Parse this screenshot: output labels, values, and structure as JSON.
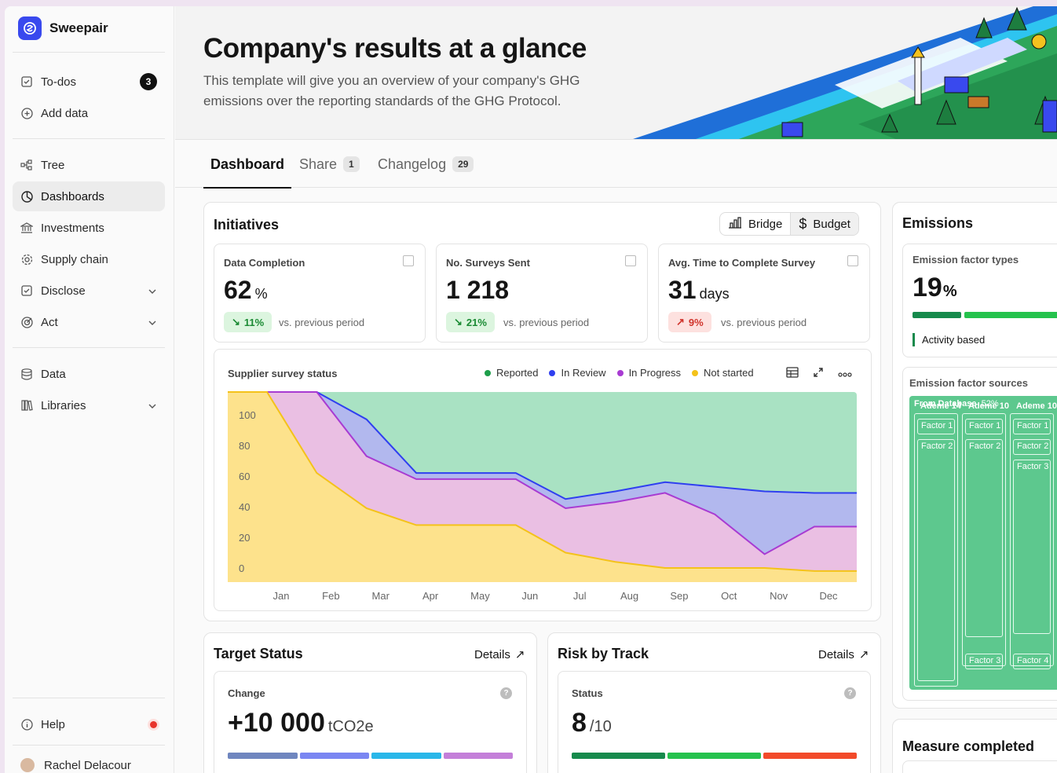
{
  "app": {
    "name": "Sweepair"
  },
  "sidebar": {
    "todos": {
      "label": "To-dos",
      "count": "3"
    },
    "add_data": "Add data",
    "tree": "Tree",
    "dashboards": "Dashboards",
    "investments": "Investments",
    "supply_chain": "Supply chain",
    "disclose": "Disclose",
    "act": "Act",
    "data": "Data",
    "libraries": "Libraries",
    "help": "Help",
    "user": "Rachel Delacour"
  },
  "header": {
    "title": "Company's results at a glance",
    "subtitle": "This template will give you an overview of your company's GHG emissions over the reporting standards of the GHG Protocol."
  },
  "tabs": [
    {
      "label": "Dashboard",
      "count": ""
    },
    {
      "label": "Share",
      "count": "1"
    },
    {
      "label": "Changelog",
      "count": "29"
    }
  ],
  "initiatives": {
    "title": "Initiatives",
    "toggle": [
      "Bridge",
      "Budget"
    ],
    "kpis": [
      {
        "label": "Data Completion",
        "value": "62",
        "unit": "%",
        "change": "11%",
        "trend": "down",
        "vs": "vs. previous period"
      },
      {
        "label": "No. Surveys Sent",
        "value": "1 218",
        "unit": "",
        "change": "21%",
        "trend": "down",
        "vs": "vs. previous period"
      },
      {
        "label": "Avg. Time to Complete Survey",
        "value": "31",
        "unit": "days",
        "change": "9%",
        "trend": "up",
        "vs": "vs. previous period"
      }
    ]
  },
  "chart_data": {
    "type": "area",
    "title": "Supplier survey status",
    "categories": [
      "Jan",
      "Feb",
      "Mar",
      "Apr",
      "May",
      "Jun",
      "Jul",
      "Aug",
      "Sep",
      "Oct",
      "Nov",
      "Dec"
    ],
    "ylim": [
      0,
      100
    ],
    "yticks": [
      0,
      20,
      40,
      60,
      80,
      100
    ],
    "legend_position": "top",
    "series": [
      {
        "name": "Reported",
        "color": "#1e9e4a",
        "values": [
          100,
          100,
          100,
          100,
          100,
          100,
          100,
          100,
          100,
          100,
          100,
          100
        ]
      },
      {
        "name": "In Review",
        "color": "#2f3ff0",
        "values": [
          115,
          115,
          97,
          62,
          62,
          62,
          45,
          50,
          56,
          53,
          50,
          49
        ]
      },
      {
        "name": "In Progress",
        "color": "#a83bd2",
        "values": [
          115,
          115,
          73,
          58,
          58,
          58,
          39,
          43,
          49,
          35,
          9,
          27
        ]
      },
      {
        "name": "Not started",
        "color": "#f4c21a",
        "values": [
          115,
          62,
          39,
          28,
          28,
          28,
          10,
          4,
          0,
          0,
          0,
          -2
        ]
      }
    ]
  },
  "target_status": {
    "title": "Target Status",
    "details": "Details",
    "label": "Change",
    "value": "+10 000",
    "unit": "tCO2e",
    "bars": [
      "#6f86bf",
      "#7a86f2",
      "#29b7e9",
      "#c47fd9"
    ]
  },
  "risk": {
    "title": "Risk by Track",
    "details": "Details",
    "label": "Status",
    "value": "8",
    "unit": "/10",
    "bars": [
      "#168a4c",
      "#25c24d",
      "#f24a2a"
    ]
  },
  "emissions": {
    "title": "Emissions",
    "types_label": "Emission factor types",
    "types_value": "19",
    "types_unit": "%",
    "activity": "Activity based",
    "sources_label": "Emission factor sources",
    "from_db": "From Database",
    "from_db_pct": "52%",
    "columns": [
      {
        "head": "Ademe",
        "num": "14",
        "boxes": [
          "Factor 1",
          "Factor 2"
        ]
      },
      {
        "head": "Ademe",
        "num": "10",
        "boxes": [
          "Factor 1",
          "Factor 2",
          "Factor 3"
        ]
      },
      {
        "head": "Ademe",
        "num": "10",
        "boxes": [
          "Factor 1",
          "Factor 2",
          "Factor 3",
          "Factor 4"
        ]
      }
    ]
  },
  "measure": {
    "title": "Measure completed"
  },
  "colors": {
    "accent": "#3949ee"
  }
}
